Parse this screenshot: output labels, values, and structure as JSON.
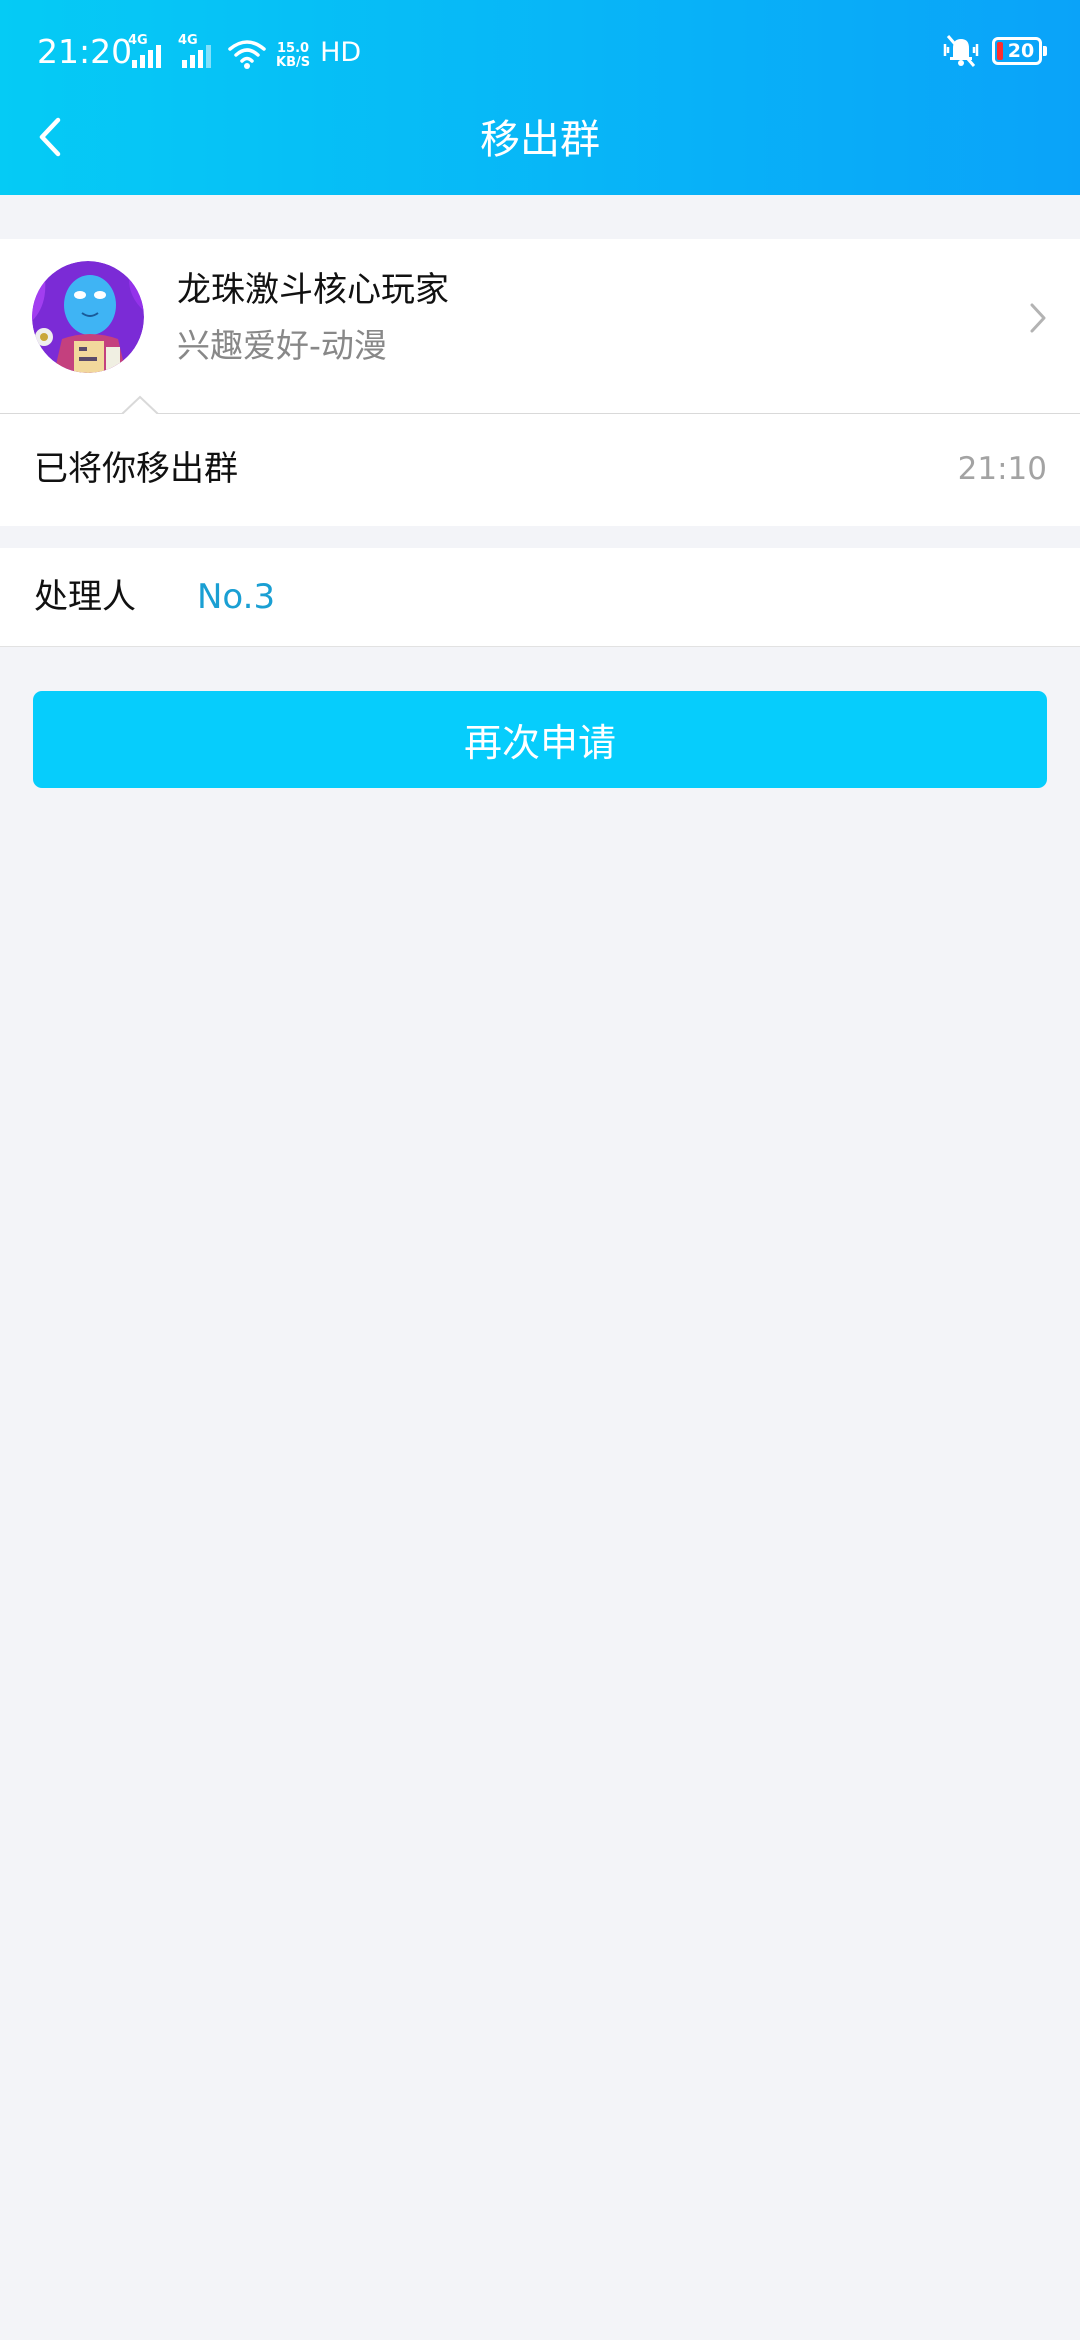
{
  "status_bar": {
    "time": "21:20",
    "network_1": "4G",
    "network_2": "4G",
    "speed_value": "15.0",
    "speed_unit": "KB/S",
    "hd": "HD",
    "battery": "20"
  },
  "header": {
    "title": "移出群",
    "back_icon": "chevron-left-icon"
  },
  "group": {
    "name": "龙珠激斗核心玩家",
    "category": "兴趣爱好-动漫"
  },
  "message": {
    "text": "已将你移出群",
    "time": "21:10"
  },
  "handler": {
    "label": "处理人",
    "value": "No.3"
  },
  "actions": {
    "reapply_label": "再次申请"
  },
  "colors": {
    "header_gradient_start": "#05cbf5",
    "header_gradient_end": "#0aa3f9",
    "button": "#06cdfc",
    "link": "#1a9fd3",
    "background": "#f3f4f8"
  }
}
